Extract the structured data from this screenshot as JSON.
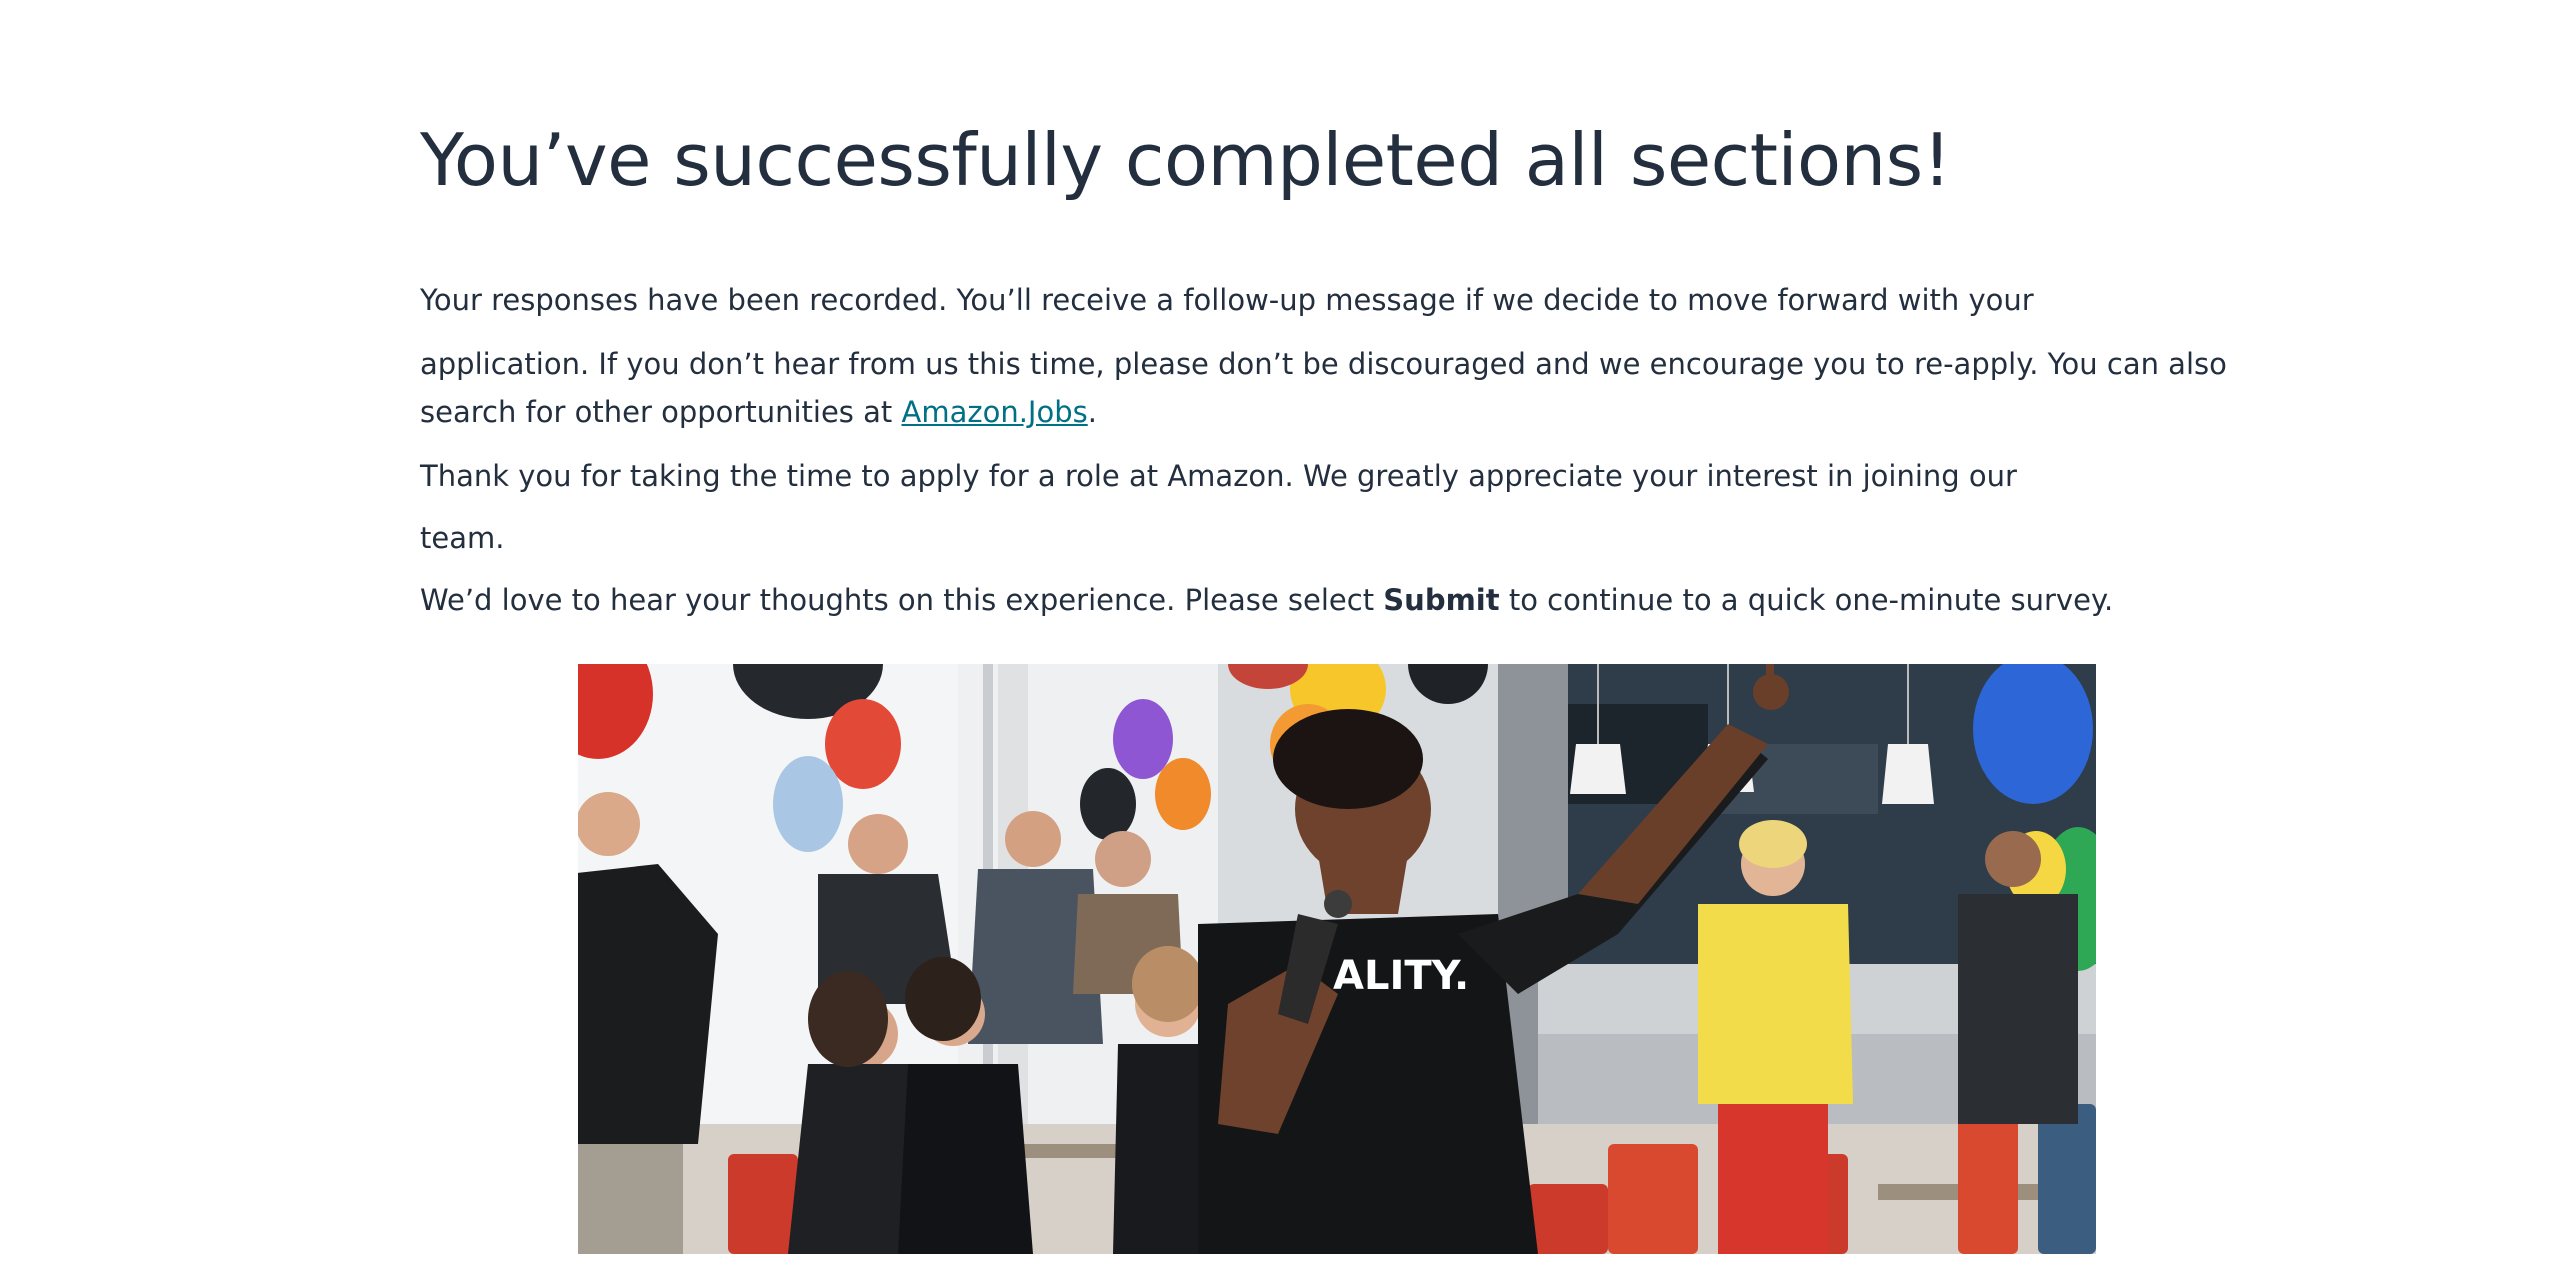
{
  "page": {
    "title": "You’ve successfully completed all sections!",
    "paragraph1": {
      "line1": "Your responses have been recorded. You’ll receive a follow-up message if we decide to move forward with your",
      "line2": "application. If you don’t hear from us this time, please don’t be discouraged and we encourage you to re-apply. You can also",
      "line3_before": "search for other opportunities at ",
      "line3_link": "Amazon.Jobs",
      "line3_after": "."
    },
    "paragraph2": {
      "line1": "Thank you for taking the time to apply for a role at Amazon. We greatly appreciate your interest in joining our",
      "line2": "team."
    },
    "paragraph3": {
      "before": "We’d love to hear your thoughts on this experience. Please select ",
      "bold": "Submit",
      "after": " to continue to a quick one-minute survey."
    },
    "image": {
      "shirt_text": "ALITY."
    }
  },
  "colors": {
    "text": "#232f3e",
    "link": "#007185",
    "background": "#ffffff"
  }
}
